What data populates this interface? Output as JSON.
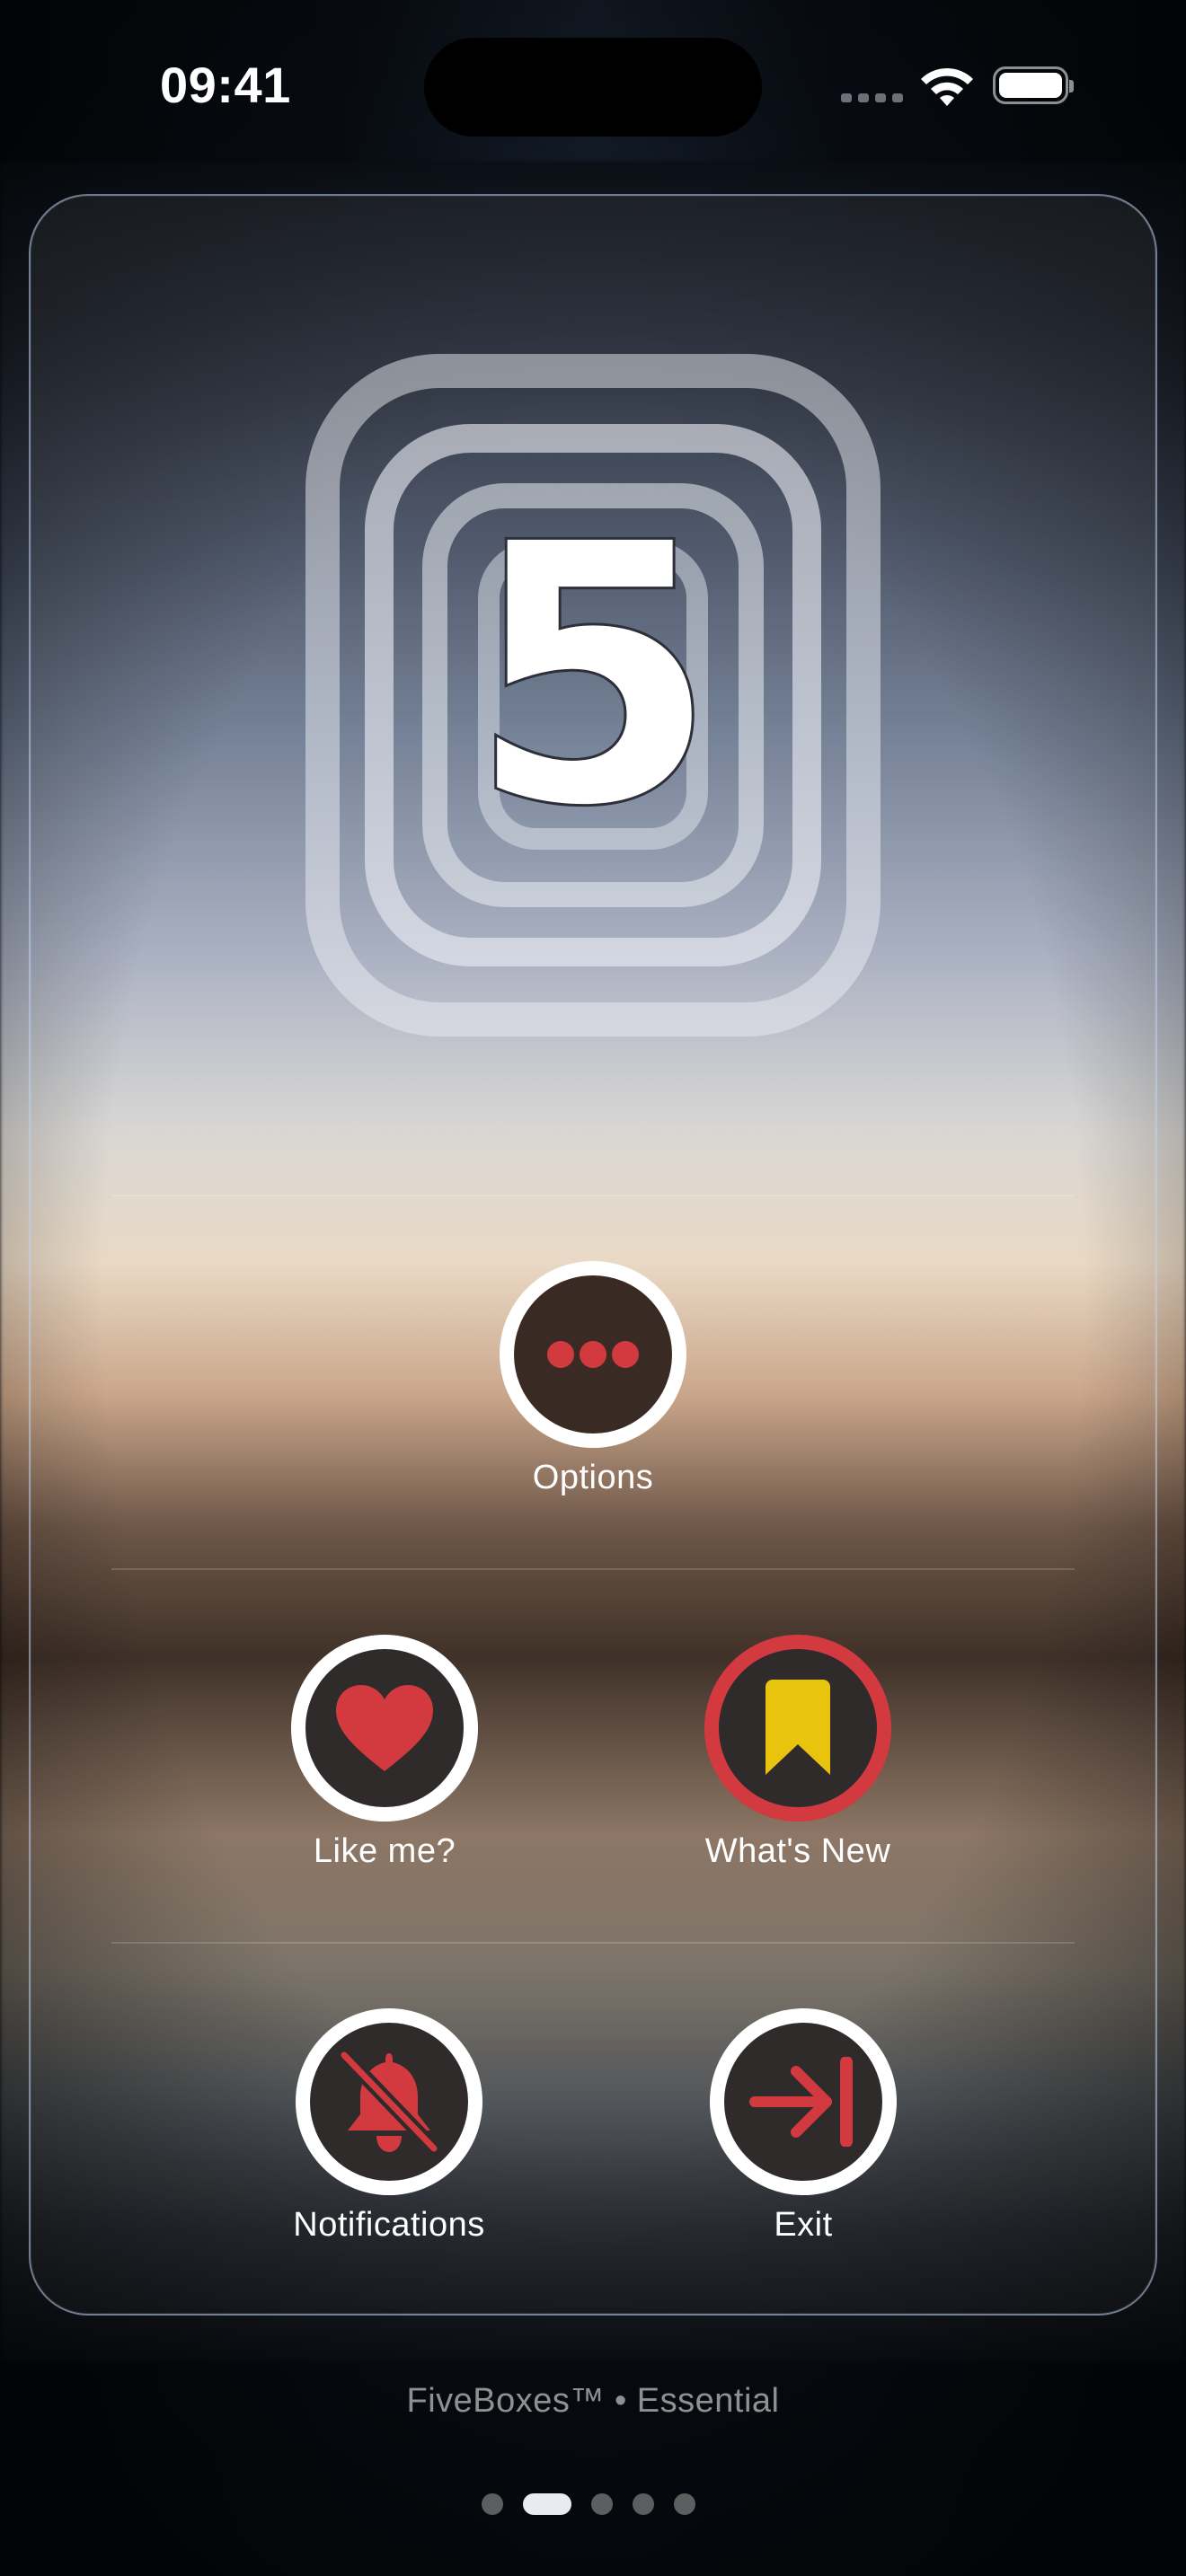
{
  "status_bar": {
    "time": "09:41"
  },
  "logo": {
    "digit": "5"
  },
  "actions": {
    "options": {
      "label": "Options",
      "icon": "ellipsis-icon"
    },
    "like": {
      "label": "Like me?",
      "icon": "heart-icon"
    },
    "whats_new": {
      "label": "What's New",
      "icon": "bookmark-icon"
    },
    "notifications": {
      "label": "Notifications",
      "icon": "bell-slash-icon"
    },
    "exit": {
      "label": "Exit",
      "icon": "exit-arrow-icon"
    }
  },
  "footer": {
    "text": "FiveBoxes™ • Essential"
  },
  "pager": {
    "pages": 5,
    "current": 2
  },
  "colors": {
    "accent": "#d23a3f",
    "bookmark": "#e8c40e",
    "button_fill": "#2f2b2b"
  }
}
